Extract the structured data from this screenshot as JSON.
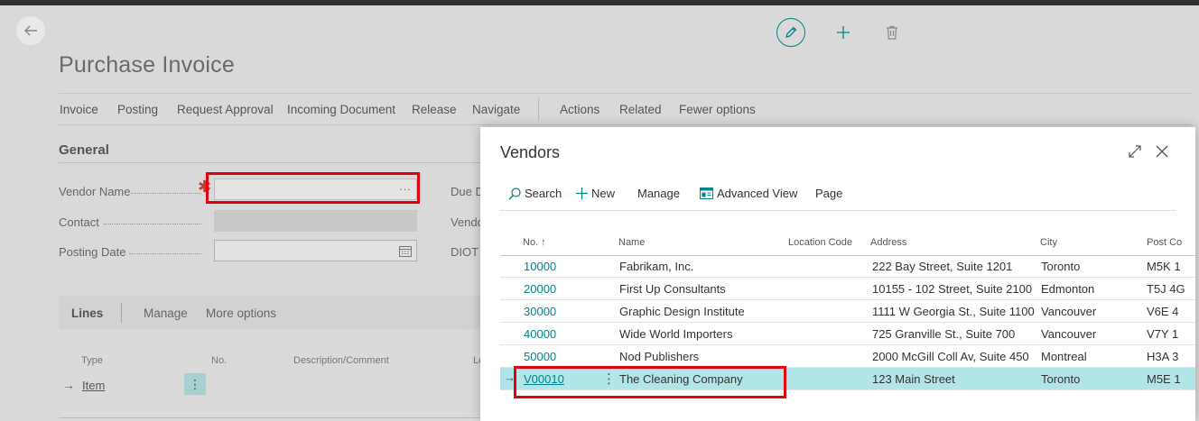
{
  "page": {
    "title": "Purchase Invoice"
  },
  "header_icons": {
    "back": "back-arrow-icon",
    "edit": "pencil-icon",
    "new": "plus-icon",
    "delete": "trash-icon"
  },
  "actions": [
    "Invoice",
    "Posting",
    "Request Approval",
    "Incoming Document",
    "Release",
    "Navigate",
    "Actions",
    "Related",
    "Fewer options"
  ],
  "general": {
    "title": "General",
    "vendor_name_label": "Vendor Name",
    "vendor_name_value": "",
    "contact_label": "Contact",
    "posting_date_label": "Posting Date",
    "posting_date_value": "",
    "right_labels": [
      "Due D",
      "Vendo",
      "DIOT T"
    ]
  },
  "lines": {
    "title": "Lines",
    "actions": [
      "Manage",
      "More options"
    ],
    "columns": [
      "Type",
      "No.",
      "Description/Comment",
      "Lo"
    ],
    "row": {
      "type": "Item"
    }
  },
  "vendors_dialog": {
    "title": "Vendors",
    "toolbar": [
      "Search",
      "New",
      "Manage",
      "Advanced View",
      "Page"
    ],
    "columns": [
      "No. ↑",
      "Name",
      "Location Code",
      "Address",
      "City",
      "Post Co"
    ],
    "rows": [
      {
        "no": "10000",
        "name": "Fabrikam, Inc.",
        "location": "",
        "address": "222 Bay Street, Suite 1201",
        "city": "Toronto",
        "post": "M5K 1"
      },
      {
        "no": "20000",
        "name": "First Up Consultants",
        "location": "",
        "address": "10155 - 102 Street, Suite 2100",
        "city": "Edmonton",
        "post": "T5J 4G"
      },
      {
        "no": "30000",
        "name": "Graphic Design Institute",
        "location": "",
        "address": "1111 W Georgia St., Suite 1100",
        "city": "Vancouver",
        "post": "V6E 4"
      },
      {
        "no": "40000",
        "name": "Wide World Importers",
        "location": "",
        "address": "725 Granville St., Suite 700",
        "city": "Vancouver",
        "post": "V7Y 1"
      },
      {
        "no": "50000",
        "name": "Nod Publishers",
        "location": "",
        "address": "2000 McGill Coll Av, Suite 450",
        "city": "Montreal",
        "post": "H3A 3"
      },
      {
        "no": "V00010",
        "name": "The Cleaning Company",
        "location": "",
        "address": "123 Main Street",
        "city": "Toronto",
        "post": "M5E 1"
      }
    ],
    "selected_row": 5
  },
  "colors": {
    "accent": "#00838a",
    "selected_row": "#b2e5e8",
    "highlight_box": "#e0000e",
    "required": "#c8382c"
  }
}
